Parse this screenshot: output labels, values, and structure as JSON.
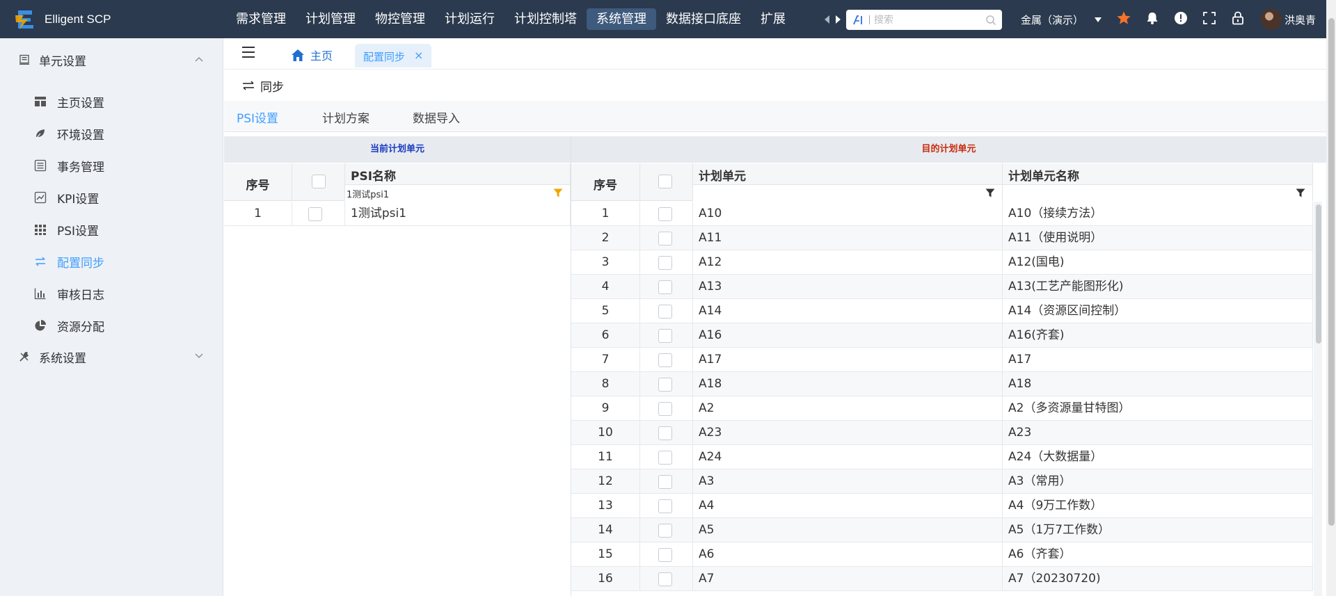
{
  "app": {
    "name": "Elligent SCP"
  },
  "topnav": {
    "items": [
      "需求管理",
      "计划管理",
      "物控管理",
      "计划运行",
      "计划控制塔",
      "系统管理",
      "数据接口底座",
      "扩展"
    ],
    "active_index": 5
  },
  "search": {
    "placeholder": "搜索"
  },
  "tenant": {
    "label": "金属（演示）"
  },
  "user": {
    "name": "洪奥青"
  },
  "colors": {
    "topbar": "#2b3a4e",
    "accent": "#409eff",
    "star": "#f5732a",
    "group_left": "#1a3bbf",
    "group_right": "#c82c0c",
    "filter_active": "#f0a500"
  },
  "sidebar": {
    "groups": [
      {
        "label": "单元设置",
        "icon": "unit-settings-icon",
        "expanded": true
      },
      {
        "label": "系统设置",
        "icon": "tools-icon",
        "expanded": false
      }
    ],
    "items": [
      {
        "label": "主页设置",
        "icon": "dashboard-icon"
      },
      {
        "label": "环境设置",
        "icon": "environment-icon"
      },
      {
        "label": "事务管理",
        "icon": "transaction-list-icon"
      },
      {
        "label": "KPI设置",
        "icon": "line-chart-icon"
      },
      {
        "label": "PSI设置",
        "icon": "grid-apps-icon"
      },
      {
        "label": "配置同步",
        "icon": "sync-arrows-icon",
        "active": true
      },
      {
        "label": "审核日志",
        "icon": "bar-chart-icon"
      },
      {
        "label": "资源分配",
        "icon": "pie-chart-icon"
      }
    ]
  },
  "tabs": {
    "home": "主页",
    "active": "配置同步",
    "close": "×"
  },
  "toolbar": {
    "sync_label": "同步"
  },
  "subtabs": {
    "items": [
      "PSI设置",
      "计划方案",
      "数据导入"
    ],
    "active_index": 0
  },
  "left_grid": {
    "group_title": "当前计划单元",
    "columns": {
      "seq": "序号",
      "name": "PSI名称"
    },
    "filter_value": "1测试psi1",
    "rows": [
      {
        "seq": "1",
        "name": "1测试psi1"
      }
    ]
  },
  "right_grid": {
    "group_title": "目的计划单元",
    "columns": {
      "seq": "序号",
      "unit": "计划单元",
      "unit_name": "计划单元名称"
    },
    "rows": [
      {
        "seq": "1",
        "unit": "A10",
        "name": "A10（接续方法）"
      },
      {
        "seq": "2",
        "unit": "A11",
        "name": "A11（使用说明）"
      },
      {
        "seq": "3",
        "unit": "A12",
        "name": "A12(国电)"
      },
      {
        "seq": "4",
        "unit": "A13",
        "name": "A13(工艺产能图形化)"
      },
      {
        "seq": "5",
        "unit": "A14",
        "name": "A14（资源区间控制）"
      },
      {
        "seq": "6",
        "unit": "A16",
        "name": "A16(齐套)"
      },
      {
        "seq": "7",
        "unit": "A17",
        "name": "A17"
      },
      {
        "seq": "8",
        "unit": "A18",
        "name": "A18"
      },
      {
        "seq": "9",
        "unit": "A2",
        "name": "A2（多资源量甘特图）"
      },
      {
        "seq": "10",
        "unit": "A23",
        "name": "A23"
      },
      {
        "seq": "11",
        "unit": "A24",
        "name": "A24（大数据量）"
      },
      {
        "seq": "12",
        "unit": "A3",
        "name": "A3（常用）"
      },
      {
        "seq": "13",
        "unit": "A4",
        "name": "A4（9万工作数）"
      },
      {
        "seq": "14",
        "unit": "A5",
        "name": "A5（1万7工作数）"
      },
      {
        "seq": "15",
        "unit": "A6",
        "name": "A6（齐套）"
      },
      {
        "seq": "16",
        "unit": "A7",
        "name": "A7（20230720)"
      }
    ]
  }
}
